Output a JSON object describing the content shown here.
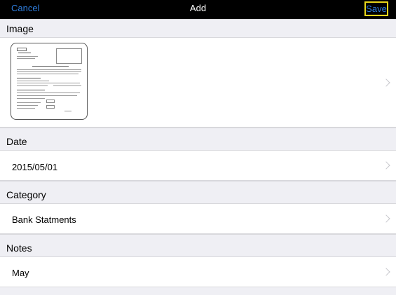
{
  "navbar": {
    "cancel_label": "Cancel",
    "title": "Add",
    "save_label": "Save"
  },
  "sections": {
    "image": {
      "header": "Image"
    },
    "date": {
      "header": "Date",
      "value": "2015/05/01"
    },
    "category": {
      "header": "Category",
      "value": "Bank Statments"
    },
    "notes": {
      "header": "Notes",
      "value": "May"
    }
  },
  "icons": {
    "chevron": "chevron-right-icon",
    "thumbnail": "document-thumbnail"
  },
  "colors": {
    "nav_background": "#000000",
    "accent": "#2f7fe0",
    "highlight_border": "#e8d61a",
    "group_background": "#efeff4",
    "chevron": "#c7c7cc"
  }
}
